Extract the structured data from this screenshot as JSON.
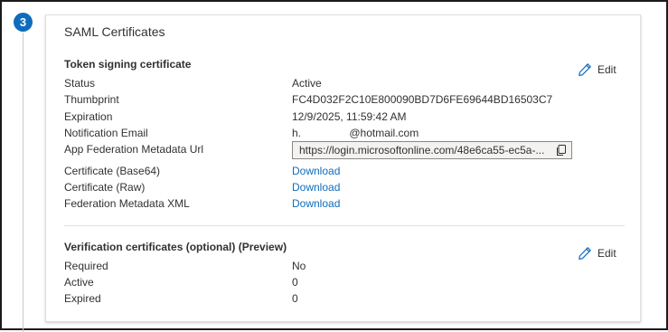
{
  "step": {
    "number": "3"
  },
  "card": {
    "title": "SAML Certificates"
  },
  "token_signing": {
    "title": "Token signing certificate",
    "edit_label": "Edit",
    "rows": [
      {
        "label": "Status",
        "value": "Active"
      },
      {
        "label": "Thumbprint",
        "value": "FC4D032F2C10E800090BD7D6FE69644BD16503C7"
      },
      {
        "label": "Expiration",
        "value": "12/9/2025, 11:59:42 AM"
      },
      {
        "label": "Notification Email",
        "value": "h.                @hotmail.com"
      },
      {
        "label": "App Federation Metadata Url",
        "value": "https://login.microsoftonline.com/48e6ca55-ec5a-..."
      },
      {
        "label": "Certificate (Base64)",
        "value": "Download"
      },
      {
        "label": "Certificate (Raw)",
        "value": "Download"
      },
      {
        "label": "Federation Metadata XML",
        "value": "Download"
      }
    ]
  },
  "verification": {
    "title": "Verification certificates (optional) (Preview)",
    "edit_label": "Edit",
    "rows": [
      {
        "label": "Required",
        "value": "No"
      },
      {
        "label": "Active",
        "value": "0"
      },
      {
        "label": "Expired",
        "value": "0"
      }
    ]
  },
  "icons": {
    "edit": "pencil-icon",
    "copy": "copy-icon"
  },
  "colors": {
    "accent": "#0f6cbd",
    "link": "#0f6cbd"
  }
}
